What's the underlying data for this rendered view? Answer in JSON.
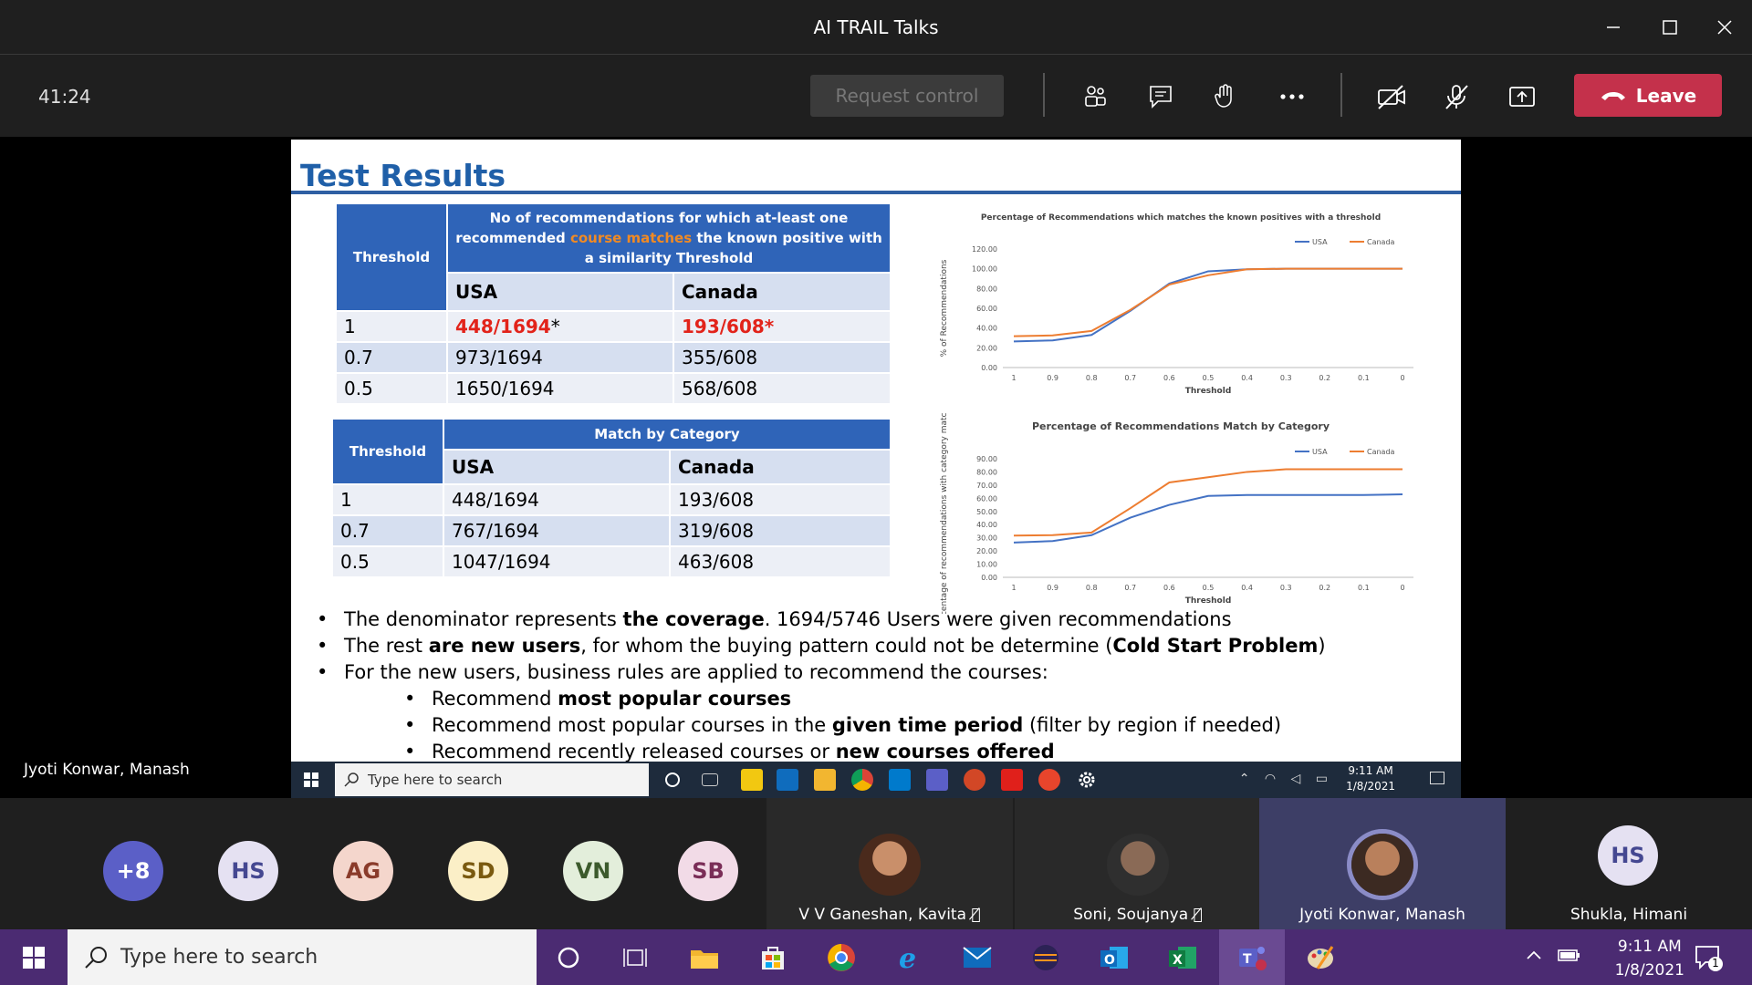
{
  "window": {
    "title": "AI TRAIL Talks"
  },
  "toolbar": {
    "timer": "41:24",
    "request_control": "Request control",
    "leave": "Leave"
  },
  "stage": {
    "presenter_name": "Jyoti Konwar, Manash"
  },
  "slide": {
    "title": "Test Results",
    "table1": {
      "threshold_header": "Threshold",
      "header_part1": "No of recommendations for which at-least one recommended ",
      "header_highlight": "course matches",
      "header_part2": " the known positive with a similarity Threshold",
      "col_usa": "USA",
      "col_canada": "Canada",
      "rows": [
        {
          "threshold": "1",
          "usa": "448/1694",
          "usa_mark": "*",
          "canada": "193/608*"
        },
        {
          "threshold": "0.7",
          "usa": "973/1694",
          "canada": "355/608"
        },
        {
          "threshold": "0.5",
          "usa": "1650/1694",
          "canada": "568/608"
        }
      ]
    },
    "table2": {
      "threshold_header": "Threshold",
      "header": "Match by Category",
      "col_usa": "USA",
      "col_canada": "Canada",
      "rows": [
        {
          "threshold": "1",
          "usa": "448/1694",
          "canada": "193/608"
        },
        {
          "threshold": "0.7",
          "usa": "767/1694",
          "canada": "319/608"
        },
        {
          "threshold": "0.5",
          "usa": "1047/1694",
          "canada": "463/608"
        }
      ]
    },
    "bullets": {
      "b1_a": "The denominator represents ",
      "b1_b": "the coverage",
      "b1_c": ". 1694/5746 Users were given recommendations",
      "b2_a": "The rest ",
      "b2_b": "are new users",
      "b2_c": ", for whom the buying pattern could not be determine (",
      "b2_d": "Cold Start Problem",
      "b2_e": ")",
      "b3": "For the new users, business rules are applied to recommend the courses:",
      "s1_a": "Recommend ",
      "s1_b": "most popular courses",
      "s2_a": "Recommend most popular courses in the ",
      "s2_b": "given time period",
      "s2_c": " (filter by region if needed)",
      "s3_a": "Recommend recently released courses or ",
      "s3_b": "new courses offered"
    }
  },
  "chart_data": [
    {
      "type": "line",
      "title": "Percentage of Recommendations which matches the known positives with a threshold",
      "xlabel": "Threshold",
      "ylabel": "% of Recommendations",
      "x": [
        "1",
        "0.9",
        "0.8",
        "0.7",
        "0.6",
        "0.5",
        "0.4",
        "0.3",
        "0.2",
        "0.1",
        "0"
      ],
      "yticks": [
        "0.00",
        "20.00",
        "40.00",
        "60.00",
        "80.00",
        "100.00",
        "120.00"
      ],
      "ylim": [
        0,
        120
      ],
      "legend_position": "top-right",
      "series": [
        {
          "name": "USA",
          "color": "#4472c4",
          "values": [
            26.4,
            27.5,
            33.0,
            57.4,
            85.0,
            97.4,
            99.5,
            100,
            100,
            100,
            100
          ]
        },
        {
          "name": "Canada",
          "color": "#ed7d31",
          "values": [
            31.7,
            32.5,
            37.0,
            58.4,
            84.0,
            93.4,
            99.5,
            100,
            100,
            100,
            100
          ]
        }
      ]
    },
    {
      "type": "line",
      "title": "Percentage of Recommendations Match by Category",
      "xlabel": "Threshold",
      "ylabel": "Percentage of recommendations with category match",
      "x": [
        "1",
        "0.9",
        "0.8",
        "0.7",
        "0.6",
        "0.5",
        "0.4",
        "0.3",
        "0.2",
        "0.1",
        "0"
      ],
      "yticks": [
        "0.00",
        "10.00",
        "20.00",
        "30.00",
        "40.00",
        "50.00",
        "60.00",
        "70.00",
        "80.00",
        "90.00"
      ],
      "ylim": [
        0,
        90
      ],
      "legend_position": "top-right",
      "series": [
        {
          "name": "USA",
          "color": "#4472c4",
          "values": [
            26.4,
            27.5,
            32.0,
            45.3,
            55.0,
            61.8,
            62.5,
            62.5,
            62.5,
            62.5,
            63.0
          ]
        },
        {
          "name": "Canada",
          "color": "#ed7d31",
          "values": [
            31.7,
            32.0,
            34.0,
            52.5,
            72.0,
            76.0,
            80.0,
            82.0,
            82.0,
            82.0,
            82.0
          ]
        }
      ]
    }
  ],
  "inner_taskbar": {
    "search_placeholder": "Type here to search",
    "time": "9:11 AM",
    "date": "1/8/2021"
  },
  "gallery": {
    "avatars": [
      {
        "initials": "+8",
        "bg": "#5b5fc7",
        "fg": "#ffffff"
      },
      {
        "initials": "HS",
        "bg": "#e5e1f2",
        "fg": "#444791"
      },
      {
        "initials": "AG",
        "bg": "#f4d6cc",
        "fg": "#8a3b2a"
      },
      {
        "initials": "SD",
        "bg": "#fbefc7",
        "fg": "#7a5a10"
      },
      {
        "initials": "VN",
        "bg": "#e3eedb",
        "fg": "#3c5a2c"
      },
      {
        "initials": "SB",
        "bg": "#f2dbe7",
        "fg": "#7a2d57"
      }
    ],
    "tiles": [
      {
        "name": "V V Ganeshan, Kavita"
      },
      {
        "name": "Soni, Soujanya"
      },
      {
        "name": "Jyoti Konwar, Manash"
      },
      {
        "name": "Shukla, Himani",
        "initials": "HS"
      }
    ]
  },
  "taskbar": {
    "search_placeholder": "Type here to search",
    "time": "9:11 AM",
    "date": "1/8/2021",
    "notification_count": "1"
  }
}
